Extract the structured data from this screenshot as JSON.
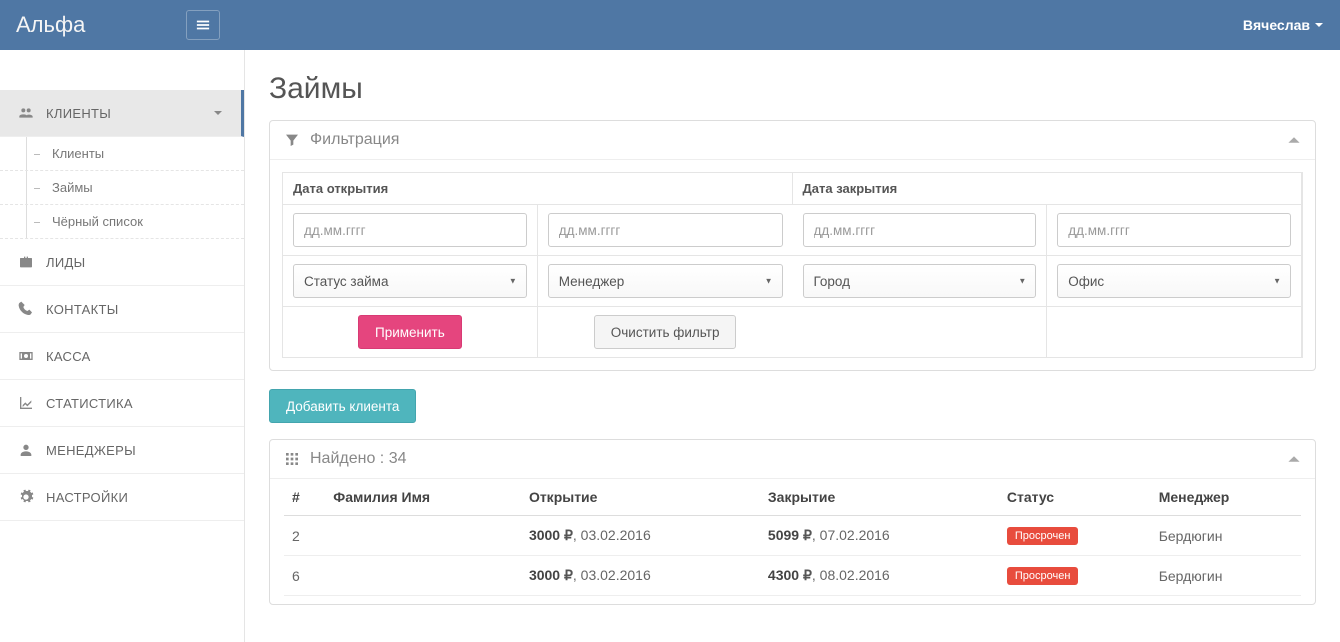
{
  "header": {
    "brand": "Альфа",
    "user": "Вячеслав"
  },
  "sidebar": {
    "items": [
      {
        "label": "КЛИЕНТЫ",
        "icon": "users",
        "active": true,
        "expandable": true
      },
      {
        "label": "ЛИДЫ",
        "icon": "briefcase"
      },
      {
        "label": "КОНТАКТЫ",
        "icon": "phone"
      },
      {
        "label": "КАССА",
        "icon": "money"
      },
      {
        "label": "СТАТИСТИКА",
        "icon": "chart"
      },
      {
        "label": "МЕНЕДЖЕРЫ",
        "icon": "user"
      },
      {
        "label": "НАСТРОЙКИ",
        "icon": "gear"
      }
    ],
    "sub": [
      "Клиенты",
      "Займы",
      "Чёрный список"
    ]
  },
  "page": {
    "title": "Займы"
  },
  "filter": {
    "panel_title": "Фильтрация",
    "open_label": "Дата открытия",
    "close_label": "Дата закрытия",
    "date_placeholder": "дд.мм.гггг",
    "status_select": "Статус займа",
    "manager_select": "Менеджер",
    "city_select": "Город",
    "office_select": "Офис",
    "apply": "Применить",
    "clear": "Очистить фильтр"
  },
  "actions": {
    "add_client": "Добавить клиента"
  },
  "results": {
    "found_label": "Найдено : 34",
    "columns": {
      "num": "#",
      "name": "Фамилия Имя",
      "open": "Открытие",
      "close": "Закрытие",
      "status": "Статус",
      "manager": "Менеджер"
    },
    "rows": [
      {
        "num": "2",
        "name": "",
        "open_amt": "3000",
        "open_date": "03.02.2016",
        "close_amt": "5099",
        "close_date": "07.02.2016",
        "status": "Просрочен",
        "manager": "Бердюгин"
      },
      {
        "num": "6",
        "name": "",
        "open_amt": "3000",
        "open_date": "03.02.2016",
        "close_amt": "4300",
        "close_date": "08.02.2016",
        "status": "Просрочен",
        "manager": "Бердюгин"
      }
    ],
    "currency": "₽"
  }
}
